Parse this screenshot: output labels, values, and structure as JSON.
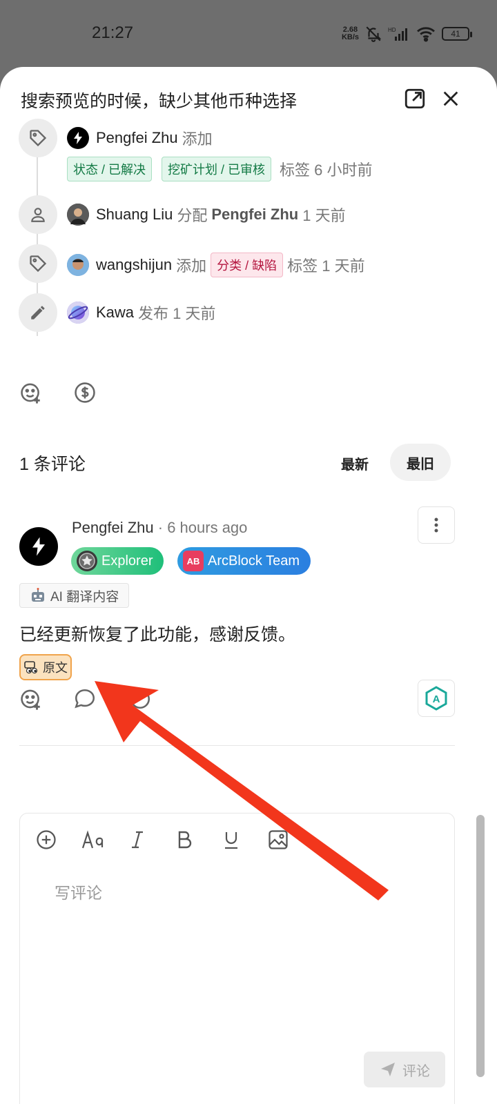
{
  "status_bar": {
    "time": "21:27",
    "net_speed_value": "2.68",
    "net_speed_unit": "KB/s",
    "battery": "41"
  },
  "header": {
    "title": "搜索预览的时候，缺少其他币种选择"
  },
  "timeline": [
    {
      "user": "Pengfei Zhu",
      "action": "添加",
      "tags": [
        "状态 / 已解决",
        "挖矿计划 / 已审核"
      ],
      "suffix": "标签 6 小时前"
    },
    {
      "user": "Shuang Liu",
      "action": "分配",
      "target": "Pengfei Zhu",
      "suffix": "1 天前"
    },
    {
      "user": "wangshijun",
      "action": "添加",
      "tag": "分类 / 缺陷",
      "suffix": "标签 1 天前"
    },
    {
      "user": "Kawa",
      "action": "发布",
      "suffix": "1 天前"
    }
  ],
  "comments_section": {
    "count_label": "1 条评论",
    "sort_newest": "最新",
    "sort_oldest": "最旧"
  },
  "comment": {
    "author": "Pengfei Zhu",
    "separator": " · ",
    "time": "6 hours ago",
    "badges": [
      "Explorer",
      "ArcBlock Team"
    ],
    "badge_arc_icon": "AB",
    "ai_label": "AI 翻译内容",
    "text": "已经更新恢复了此功能，感谢反馈。",
    "original_label": "原文"
  },
  "editor": {
    "placeholder": "写评论",
    "submit_label": "评论"
  },
  "colors": {
    "accent_green": "#1fbf7a",
    "accent_blue": "#2b7fe0",
    "annotation_arrow": "#f2361c"
  }
}
